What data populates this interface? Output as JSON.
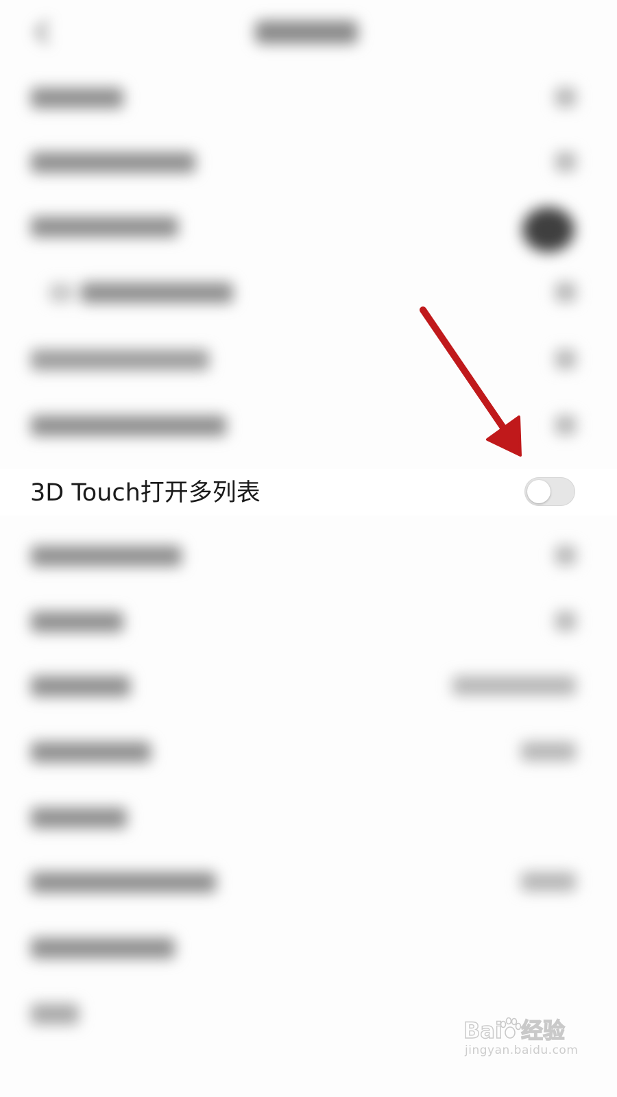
{
  "screen": {
    "background": "#fdfdfd"
  },
  "focused_setting": {
    "label": "3D Touch打开多列表",
    "toggle_state": "off",
    "toggle_on": false
  },
  "annotation": {
    "arrow_color": "#c0191b",
    "arrow_target": "toggle-switch"
  },
  "watermark": {
    "logo_text": "Baidu经验",
    "url_text": "jingyan.baidu.com"
  },
  "icons": {
    "back": "chevron-left-icon"
  }
}
